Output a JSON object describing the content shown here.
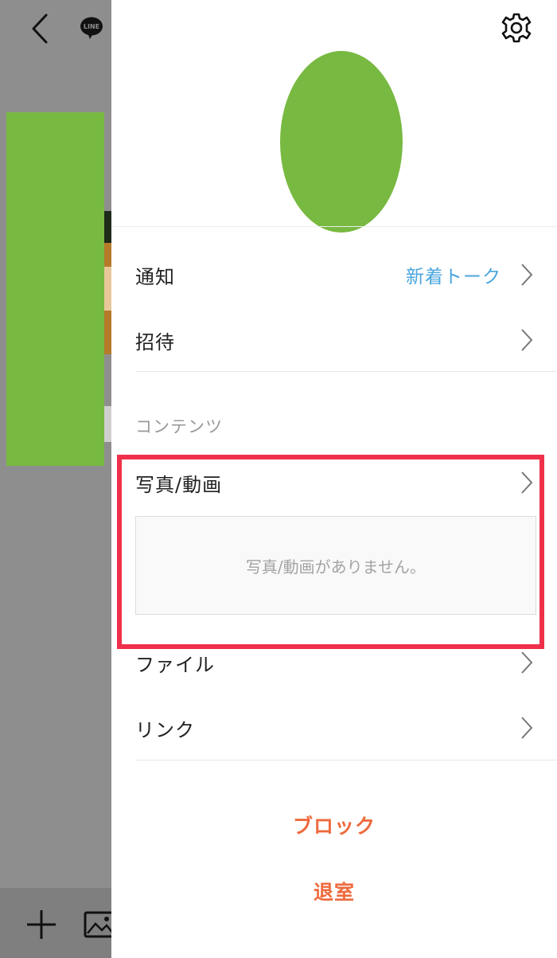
{
  "background": {
    "line_logo_text": "LINE"
  },
  "drawer": {
    "rows": {
      "notification": {
        "label": "通知",
        "value": "新着トーク"
      },
      "invite": {
        "label": "招待"
      }
    },
    "contents_section_title": "コンテンツ",
    "media": {
      "label": "写真/動画",
      "empty_message": "写真/動画がありません。"
    },
    "files": {
      "label": "ファイル"
    },
    "links": {
      "label": "リンク"
    },
    "actions": {
      "block": "ブロック",
      "leave": "退室"
    }
  },
  "colors": {
    "accent_link": "#4aa6de",
    "danger_action": "#ee6a3d",
    "highlight": "#f0304a",
    "avatar": "#78b941"
  }
}
